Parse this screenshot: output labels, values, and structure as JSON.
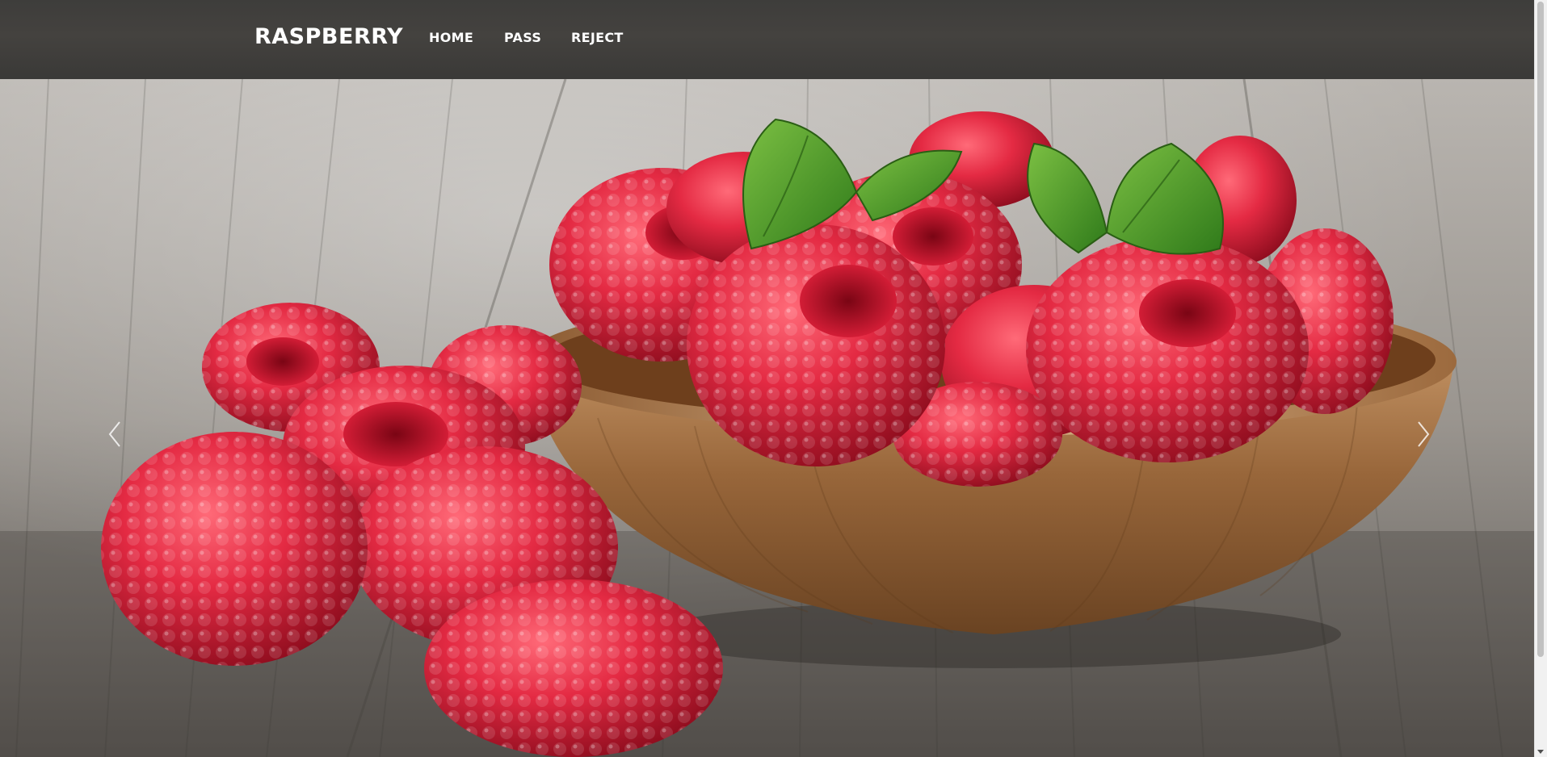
{
  "nav": {
    "brand": "RASPBERRY",
    "links": [
      "HOME",
      "PASS",
      "REJECT"
    ]
  },
  "hero": {
    "image_subject": "raspberries in a wooden bowl on a wooden table",
    "prev_icon": "chevron-left-icon",
    "next_icon": "chevron-right-icon"
  },
  "colors": {
    "navbar": "#403f3d",
    "nav_text": "#ffffff",
    "berry": "#d8213a",
    "leaf": "#4e9a28",
    "bowl": "#9b6a3e",
    "wood": "#8a8680"
  }
}
